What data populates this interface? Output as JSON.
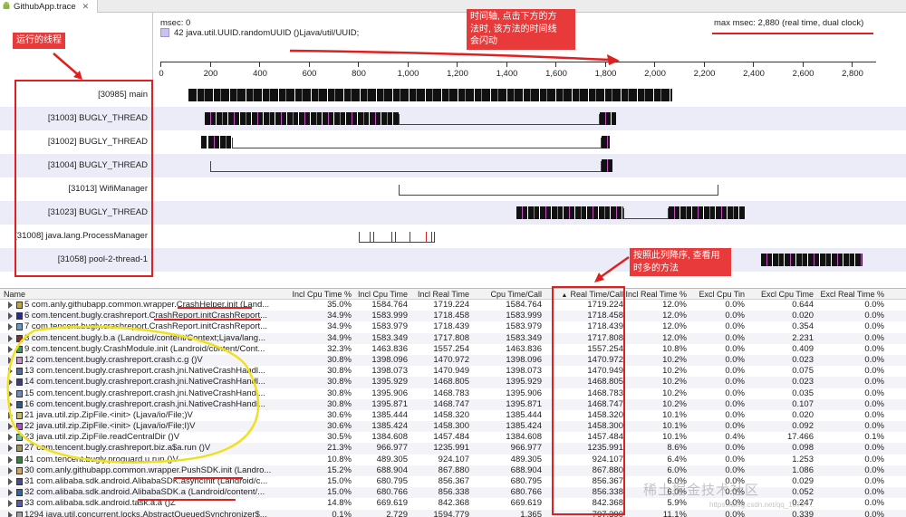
{
  "tab": {
    "title": "GithubApp.trace",
    "close": "✕"
  },
  "header": {
    "msec_label": "msec: 0",
    "selected_method": "42 java.util.UUID.randomUUID ()Ljava/util/UUID;",
    "max_msec": "max msec: 2,880 (real time, dual clock)"
  },
  "ruler": {
    "ticks": [
      "0",
      "200",
      "400",
      "600",
      "800",
      "1,000",
      "1,200",
      "1,400",
      "1,600",
      "1,800",
      "2,000",
      "2,200",
      "2,400",
      "2,600",
      "2,800"
    ]
  },
  "threads": [
    {
      "name": "[30985] main"
    },
    {
      "name": "[31003] BUGLY_THREAD"
    },
    {
      "name": "[31002] BUGLY_THREAD"
    },
    {
      "name": "[31004] BUGLY_THREAD"
    },
    {
      "name": "[31013] WifiManager"
    },
    {
      "name": "[31023] BUGLY_THREAD"
    },
    {
      "name": "[31008] java.lang.ProcessManager"
    },
    {
      "name": "[31058] pool-2-thread-1"
    }
  ],
  "annotations": {
    "threads_note": "运行的线程",
    "timeline_note_1": "时间轴, 点击下方的方",
    "timeline_note_2": "法时, 该方法的时间线",
    "timeline_note_3": "会闪动",
    "sort_note_1": "按照此列降序, 查看用",
    "sort_note_2": "时多的方法"
  },
  "table": {
    "columns": [
      "Name",
      "Incl Cpu Time %",
      "Incl Cpu Time",
      "Incl Real Time",
      "Cpu Time/Call",
      "Real Time/Call",
      "Incl Real Time %",
      "Excl Cpu Tin",
      "Excl Cpu Time",
      "Excl Real Time %"
    ],
    "sort_indicator": "▲",
    "rows": [
      {
        "name": "5 com.anly.githubapp.common.wrapper.CrashHelper.init (Land...",
        "color": "#c8a828",
        "c": [
          "35.0%",
          "1584.764",
          "1719.224",
          "1584.764",
          "1719.224",
          "12.0%",
          "0.0%",
          "0.644",
          "0.0%"
        ]
      },
      {
        "name": "6 com.tencent.bugly.crashreport.CrashReport.initCrashReport...",
        "color": "#2a2a9a",
        "c": [
          "34.9%",
          "1583.999",
          "1718.458",
          "1583.999",
          "1718.458",
          "12.0%",
          "0.0%",
          "0.020",
          "0.0%"
        ]
      },
      {
        "name": "7 com.tencent.bugly.crashreport.CrashReport.initCrashReport...",
        "color": "#5a9ad8",
        "c": [
          "34.9%",
          "1583.979",
          "1718.439",
          "1583.979",
          "1718.439",
          "12.0%",
          "0.0%",
          "0.354",
          "0.0%"
        ]
      },
      {
        "name": "8 com.tencent.bugly.b.a (Landroid/content/Context;Ljava/lang...",
        "color": "#8a2a2a",
        "c": [
          "34.9%",
          "1583.349",
          "1717.808",
          "1583.349",
          "1717.808",
          "12.0%",
          "0.0%",
          "2.231",
          "0.0%"
        ]
      },
      {
        "name": "9 com.tencent.bugly.CrashModule.init (Landroid/content/Cont...",
        "color": "#3a9a6a",
        "c": [
          "32.3%",
          "1463.836",
          "1557.254",
          "1463.836",
          "1557.254",
          "10.8%",
          "0.0%",
          "0.409",
          "0.0%"
        ]
      },
      {
        "name": "12 com.tencent.bugly.crashreport.crash.c.g ()V",
        "color": "#c890c0",
        "c": [
          "30.8%",
          "1398.096",
          "1470.972",
          "1398.096",
          "1470.972",
          "10.2%",
          "0.0%",
          "0.023",
          "0.0%"
        ]
      },
      {
        "name": "13 com.tencent.bugly.crashreport.crash.jni.NativeCrashHandl...",
        "color": "#4a6ab0",
        "c": [
          "30.8%",
          "1398.073",
          "1470.949",
          "1398.073",
          "1470.949",
          "10.2%",
          "0.0%",
          "0.075",
          "0.0%"
        ]
      },
      {
        "name": "14 com.tencent.bugly.crashreport.crash.jni.NativeCrashHandl...",
        "color": "#3a3a8a",
        "c": [
          "30.8%",
          "1395.929",
          "1468.805",
          "1395.929",
          "1468.805",
          "10.2%",
          "0.0%",
          "0.023",
          "0.0%"
        ]
      },
      {
        "name": "15 com.tencent.bugly.crashreport.crash.jni.NativeCrashHandl...",
        "color": "#6a8ac8",
        "c": [
          "30.8%",
          "1395.906",
          "1468.783",
          "1395.906",
          "1468.783",
          "10.2%",
          "0.0%",
          "0.035",
          "0.0%"
        ]
      },
      {
        "name": "16 com.tencent.bugly.crashreport.crash.jni.NativeCrashHandl...",
        "color": "#2a5a8a",
        "c": [
          "30.8%",
          "1395.871",
          "1468.747",
          "1395.871",
          "1468.747",
          "10.2%",
          "0.0%",
          "0.107",
          "0.0%"
        ]
      },
      {
        "name": "21 java.util.zip.ZipFile.<init> (Ljava/io/File;)V",
        "color": "#c8c040",
        "c": [
          "30.6%",
          "1385.444",
          "1458.320",
          "1385.444",
          "1458.320",
          "10.1%",
          "0.0%",
          "0.020",
          "0.0%"
        ]
      },
      {
        "name": "22 java.util.zip.ZipFile.<init> (Ljava/io/File;I)V",
        "color": "#b050c8",
        "c": [
          "30.6%",
          "1385.424",
          "1458.300",
          "1385.424",
          "1458.300",
          "10.1%",
          "0.0%",
          "0.092",
          "0.0%"
        ]
      },
      {
        "name": "23 java.util.zip.ZipFile.readCentralDir ()V",
        "color": "#60c0a0",
        "c": [
          "30.5%",
          "1384.608",
          "1457.484",
          "1384.608",
          "1457.484",
          "10.1%",
          "0.4%",
          "17.466",
          "0.1%"
        ]
      },
      {
        "name": "27 com.tencent.bugly.crashreport.biz.a$a.run ()V",
        "color": "#9a9a4a",
        "c": [
          "21.3%",
          "966.977",
          "1235.991",
          "966.977",
          "1235.991",
          "8.6%",
          "0.0%",
          "0.098",
          "0.0%"
        ]
      },
      {
        "name": "41 com.tencent.bugly.proguard.u.run ()V",
        "color": "#2a8a3a",
        "c": [
          "10.8%",
          "489.305",
          "924.107",
          "489.305",
          "924.107",
          "6.4%",
          "0.0%",
          "1.253",
          "0.0%"
        ]
      },
      {
        "name": "30 com.anly.githubapp.common.wrapper.PushSDK.init (Landro...",
        "color": "#e0a050",
        "c": [
          "15.2%",
          "688.904",
          "867.880",
          "688.904",
          "867.880",
          "6.0%",
          "0.0%",
          "1.086",
          "0.0%"
        ]
      },
      {
        "name": "31 com.alibaba.sdk.android.AlibabaSDK.asyncInit (Landroid/c...",
        "color": "#4a4a9a",
        "c": [
          "15.0%",
          "680.795",
          "856.367",
          "680.795",
          "856.367",
          "6.0%",
          "0.0%",
          "0.029",
          "0.0%"
        ]
      },
      {
        "name": "32 com.alibaba.sdk.android.AlibabaSDK.a (Landroid/content/...",
        "color": "#2a6a9a",
        "c": [
          "15.0%",
          "680.766",
          "856.338",
          "680.766",
          "856.338",
          "6.0%",
          "0.0%",
          "0.052",
          "0.0%"
        ]
      },
      {
        "name": "33 com.alibaba.sdk.android.task.a.a ()Z",
        "color": "#5a5ab0",
        "c": [
          "14.8%",
          "669.619",
          "842.368",
          "669.619",
          "842.368",
          "5.9%",
          "0.0%",
          "0.247",
          "0.0%"
        ]
      },
      {
        "name": "1294 java.util.concurrent.locks.AbstractQueuedSynchronizer$...",
        "color": "#a0a0a0",
        "c": [
          "0.1%",
          "2.729",
          "1594.779",
          "1.365",
          "797.390",
          "11.1%",
          "0.0%",
          "0.339",
          "0.0%"
        ]
      }
    ]
  },
  "watermark": {
    "text": "稀土掘金技术社区",
    "sub": "https://blog.csdn.net/qq_18757..."
  },
  "colors": {
    "accent_red": "#e02020",
    "thread_alt_bg": "#ececf8",
    "highlight_yellow": "#f0e020"
  }
}
